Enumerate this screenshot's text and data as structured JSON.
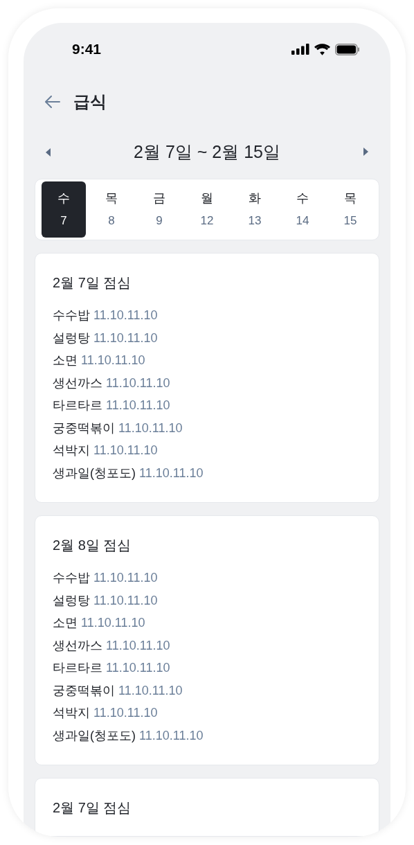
{
  "status_bar": {
    "time": "9:41"
  },
  "header": {
    "title": "급식"
  },
  "week": {
    "range": "2월 7일 ~ 2월 15일"
  },
  "days": [
    {
      "weekday": "수",
      "date": "7",
      "selected": true
    },
    {
      "weekday": "목",
      "date": "8",
      "selected": false
    },
    {
      "weekday": "금",
      "date": "9",
      "selected": false
    },
    {
      "weekday": "월",
      "date": "12",
      "selected": false
    },
    {
      "weekday": "화",
      "date": "13",
      "selected": false
    },
    {
      "weekday": "수",
      "date": "14",
      "selected": false
    },
    {
      "weekday": "목",
      "date": "15",
      "selected": false
    }
  ],
  "meals": [
    {
      "title": "2월 7일 점심",
      "items": [
        {
          "name": "수수밥",
          "code": "11.10.11.10"
        },
        {
          "name": "설렁탕",
          "code": "11.10.11.10"
        },
        {
          "name": "소면",
          "code": "11.10.11.10"
        },
        {
          "name": "생선까스",
          "code": "11.10.11.10"
        },
        {
          "name": "타르타르",
          "code": "11.10.11.10"
        },
        {
          "name": "궁중떡볶이",
          "code": "11.10.11.10"
        },
        {
          "name": "석박지",
          "code": "11.10.11.10"
        },
        {
          "name": "생과일(청포도)",
          "code": "11.10.11.10"
        }
      ]
    },
    {
      "title": "2월 8일 점심",
      "items": [
        {
          "name": "수수밥",
          "code": "11.10.11.10"
        },
        {
          "name": "설렁탕",
          "code": "11.10.11.10"
        },
        {
          "name": "소면",
          "code": "11.10.11.10"
        },
        {
          "name": "생선까스",
          "code": "11.10.11.10"
        },
        {
          "name": "타르타르",
          "code": "11.10.11.10"
        },
        {
          "name": "궁중떡볶이",
          "code": "11.10.11.10"
        },
        {
          "name": "석박지",
          "code": "11.10.11.10"
        },
        {
          "name": "생과일(청포도)",
          "code": "11.10.11.10"
        }
      ]
    },
    {
      "title": "2월 7일 점심"
    }
  ]
}
